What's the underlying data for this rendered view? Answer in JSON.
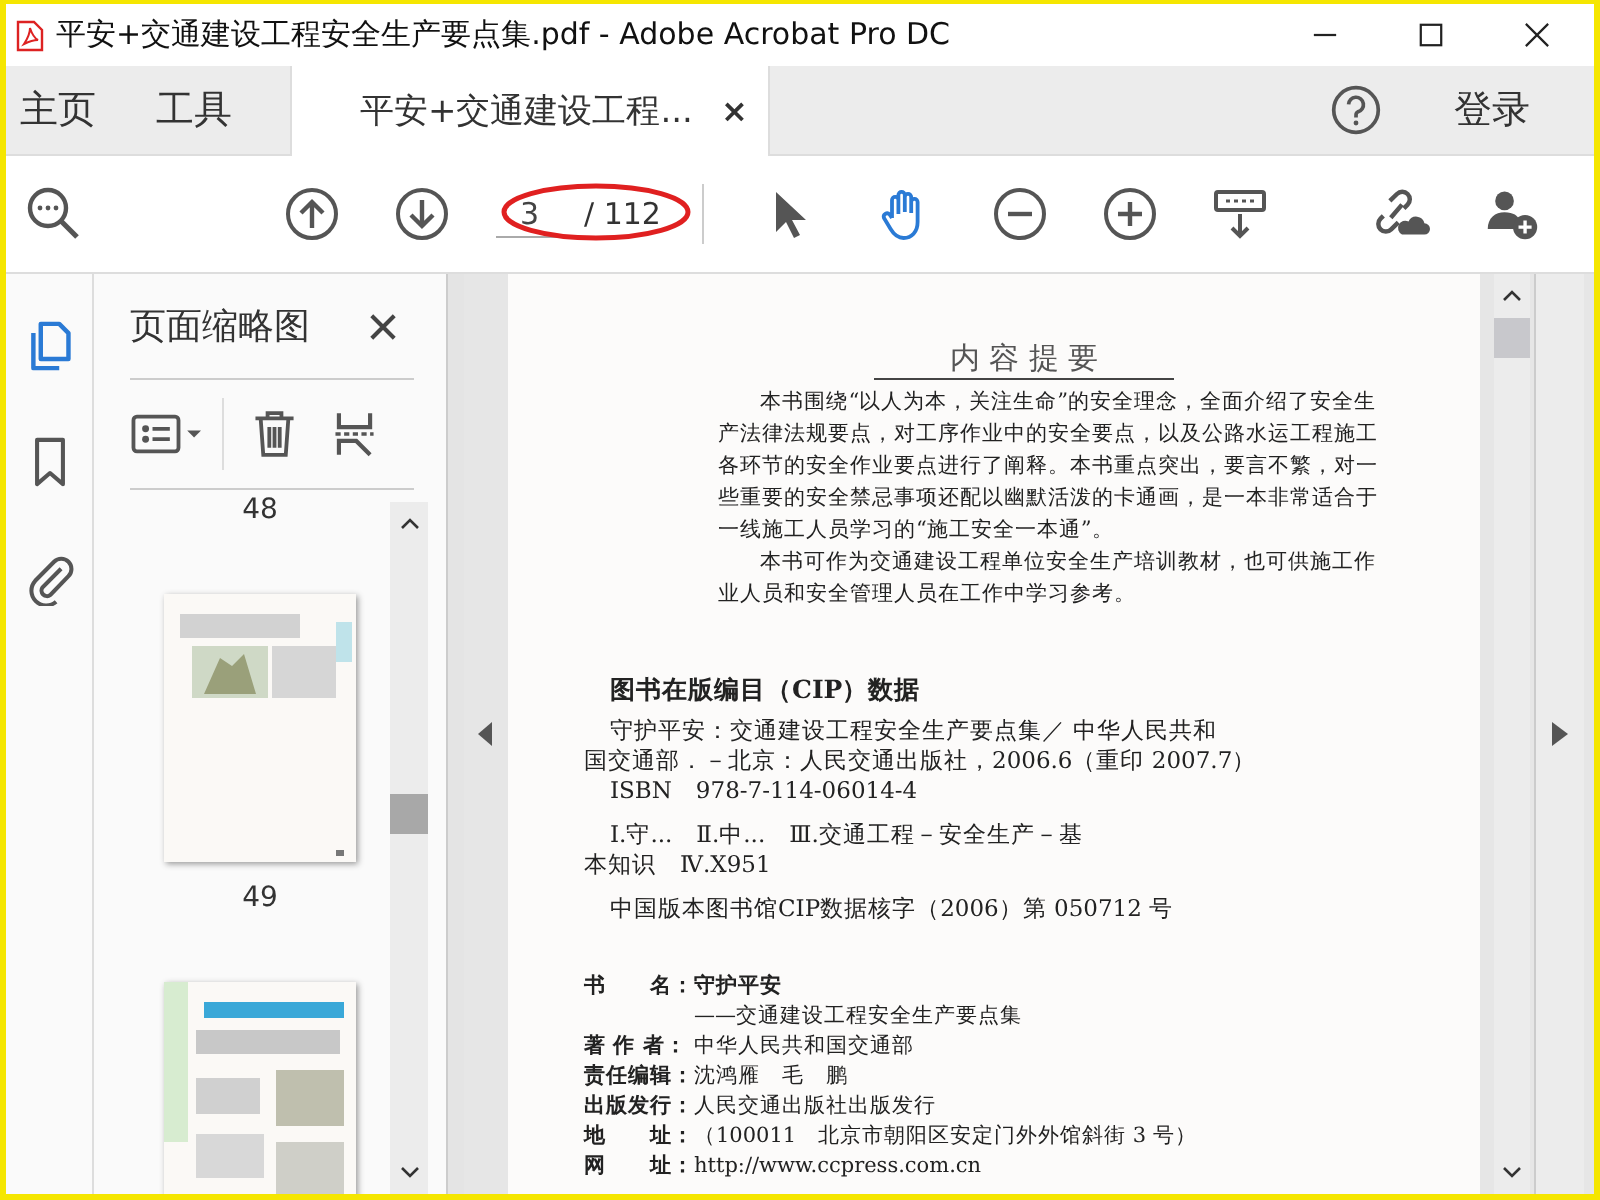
{
  "window": {
    "title": "平安+交通建设工程安全生产要点集.pdf - Adobe Acrobat Pro DC"
  },
  "nav_tabs": [
    {
      "label": "主页",
      "selected": false
    },
    {
      "label": "工具",
      "selected": false
    },
    {
      "label": "平安+交通建设工程...",
      "selected": true,
      "close": "×"
    }
  ],
  "account": {
    "sign_in": "登录"
  },
  "toolbar": {
    "page_field": {
      "value": "3",
      "total": "/ 112"
    },
    "tools": [
      {
        "kind": "select",
        "selected": false
      },
      {
        "kind": "hand",
        "selected": true
      }
    ]
  },
  "rail": [
    {
      "kind": "pages",
      "selected": true
    },
    {
      "kind": "bookmarks",
      "selected": false
    },
    {
      "kind": "attachments",
      "selected": false
    }
  ],
  "sidebar": {
    "title": "页面缩略图",
    "items": [
      {
        "kind": "label",
        "text": "48"
      },
      {
        "kind": "thumbnail"
      },
      {
        "kind": "label",
        "text": "49"
      },
      {
        "kind": "thumbnail"
      }
    ]
  },
  "document": {
    "heading": "内 容 提 要",
    "paragraphs": [
      "本书围绕“以人为本，关注生命”的安全理念，全面介绍了安全生产法律法规要点，对工序作业中的安全要点，以及公路水运工程施工各环节的安全作业要点进行了阐释。本书重点突出，要言不繁，对一些重要的安全禁忌事项还配以幽默活泼的卡通画，是一本非常适合于一线施工人员学习的“施工安全一本通”。",
      "本书可作为交通建设工程单位安全生产培训教材，也可供施工作业人员和安全管理人员在工作中学习参考。"
    ],
    "cip_title": "图书在版编目（CIP）数据",
    "cip_blocks": [
      [
        {
          "text": "守护平安：交通建设工程安全生产要点集／ 中华人民共和",
          "indent": true
        },
        {
          "text": "国交通部．－北京：人民交通出版社，2006.6（重印 2007.7）",
          "indent": false
        },
        {
          "text": "ISBN　978-7-114-06014-4",
          "indent": true
        }
      ],
      [
        {
          "text": "Ⅰ.守...　Ⅱ.中...　Ⅲ.交通工程－安全生产－基",
          "indent": true
        },
        {
          "text": "本知识　Ⅳ.X951",
          "indent": false
        }
      ],
      [
        {
          "text": "中国版本图书馆CIP数据核字（2006）第 050712 号",
          "indent": true
        }
      ]
    ],
    "info": [
      {
        "label": "书　　名：",
        "value": "守护平安"
      },
      {
        "value": "——交通建设工程安全生产要点集"
      },
      {
        "label": "著 作 者：",
        "value": "中华人民共和国交通部"
      },
      {
        "label": "责任编辑：",
        "value": "沈鸿雁　毛　鹏"
      },
      {
        "label": "出版发行：",
        "value": "人民交通出版社出版发行"
      },
      {
        "label": "地　　址：",
        "value": "（100011　北京市朝阳区安定门外外馆斜街 3 号）"
      },
      {
        "label": "网　　址：",
        "value": "http://www.ccpress.com.cn"
      }
    ]
  }
}
